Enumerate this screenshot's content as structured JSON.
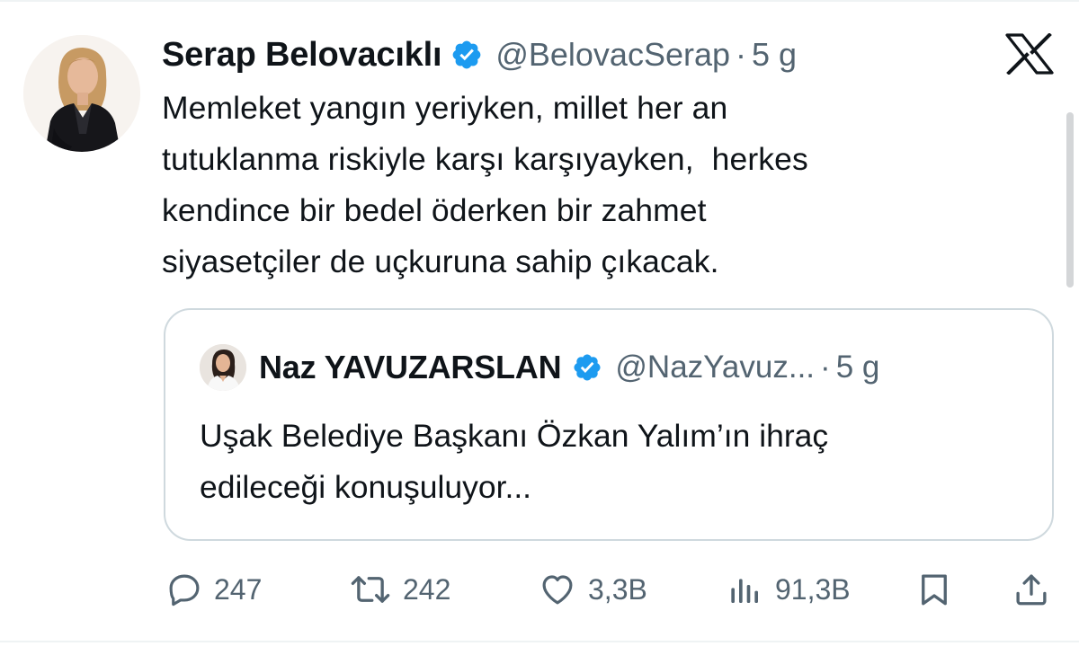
{
  "tweet": {
    "author_name": "Serap Belovacıklı",
    "handle": "@BelovacSerap",
    "separator": "·",
    "time": "5 g",
    "lines": [
      "Memleket yangın yeriyken, millet her an",
      "tutuklanma riskiyle karşı karşıyayken,  herkes",
      "kendince bir bedel öderken bir zahmet",
      "siyasetçiler de uçkuruna sahip çıkacak."
    ]
  },
  "quote": {
    "author_name": "Naz YAVUZARSLAN",
    "handle": "@NazYavuz...",
    "separator": "·",
    "time": "5 g",
    "lines": [
      "Uşak Belediye Başkanı Özkan Yalım’ın ihraç",
      "edileceği konuşuluyor..."
    ]
  },
  "actions": {
    "replies": "247",
    "retweets": "242",
    "likes": "3,3B",
    "views": "91,3B"
  },
  "icons": {
    "platform_logo": "x-logo-icon",
    "verified": "verified-badge-icon",
    "reply": "reply-icon",
    "retweet": "retweet-icon",
    "like": "heart-icon",
    "views": "views-icon",
    "bookmark": "bookmark-icon",
    "share": "share-icon"
  },
  "colors": {
    "text": "#0f1419",
    "secondary": "#536471",
    "verified": "#1d9bf0",
    "border": "#cfd9de"
  }
}
